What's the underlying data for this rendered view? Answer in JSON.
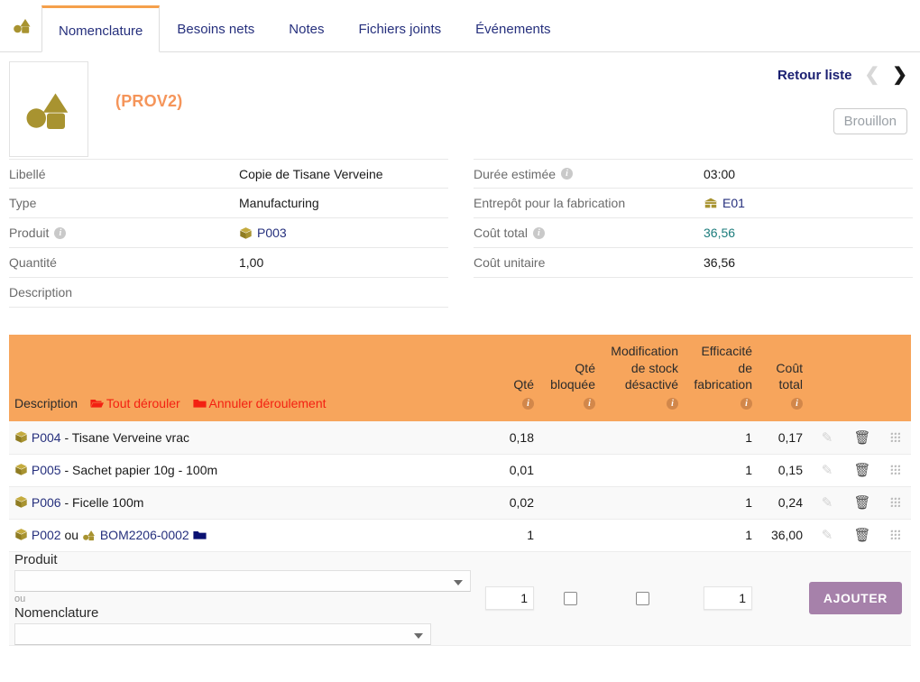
{
  "app": {
    "logo_icon": "bom-shapes-icon"
  },
  "tabs": [
    {
      "label": "Nomenclature",
      "active": true
    },
    {
      "label": "Besoins nets",
      "active": false
    },
    {
      "label": "Notes",
      "active": false
    },
    {
      "label": "Fichiers joints",
      "active": false
    },
    {
      "label": "Événements",
      "active": false
    }
  ],
  "header": {
    "thumbnail_icon": "bom-shapes-icon",
    "reference": "(PROV2)",
    "back_to_list": "Retour liste",
    "prev_icon": "chevron-left-icon",
    "next_icon": "chevron-right-icon",
    "status_badge": "Brouillon"
  },
  "info_left": [
    {
      "label": "Libellé",
      "info": false,
      "value": "Copie de Tisane Verveine",
      "style": "plain"
    },
    {
      "label": "Type",
      "info": false,
      "value": "Manufacturing",
      "style": "plain"
    },
    {
      "label": "Produit",
      "info": true,
      "value": "P003",
      "style": "link",
      "icon": "package-box-icon"
    },
    {
      "label": "Quantité",
      "info": false,
      "value": "1,00",
      "style": "plain"
    },
    {
      "label": "Description",
      "info": false,
      "value": "",
      "style": "plain"
    }
  ],
  "info_right": [
    {
      "label": "Durée estimée",
      "info": true,
      "value": "03:00",
      "style": "plain"
    },
    {
      "label": "Entrepôt pour la fabrication",
      "info": false,
      "value": "E01",
      "style": "link",
      "icon": "warehouse-icon"
    },
    {
      "label": "Coût total",
      "info": true,
      "value": "36,56",
      "style": "teal"
    },
    {
      "label": "Coût unitaire",
      "info": false,
      "value": "36,56",
      "style": "plain"
    }
  ],
  "bom_table": {
    "desc_header": "Description",
    "expand_all": "Tout dérouler",
    "expand_all_icon": "folder-open-icon",
    "collapse_all": "Annuler déroulement",
    "collapse_all_icon": "folder-closed-icon",
    "columns": [
      {
        "lines": [
          "Qté"
        ],
        "info": true
      },
      {
        "lines": [
          "Qté",
          "bloquée"
        ],
        "info": true
      },
      {
        "lines": [
          "Modification",
          "de stock",
          "désactivé"
        ],
        "info": true
      },
      {
        "lines": [
          "Efficacité",
          "de",
          "fabrication"
        ],
        "info": true
      },
      {
        "lines": [
          "Coût",
          "total"
        ],
        "info": true
      }
    ],
    "rows": [
      {
        "icon": "package-box-icon",
        "code": "P004",
        "text": " - Tisane Verveine vrac",
        "qte": "0,18",
        "qte_bloquee": "",
        "modif_stock": "",
        "efficacite": "1",
        "cout_total": "0,17",
        "edit_icon": "pencil-icon",
        "delete_icon": "trash-icon",
        "drag_icon": "drag-handle-icon"
      },
      {
        "icon": "package-box-icon",
        "code": "P005",
        "text": " - Sachet papier 10g - 100m",
        "qte": "0,01",
        "qte_bloquee": "",
        "modif_stock": "",
        "efficacite": "1",
        "cout_total": "0,15",
        "edit_icon": "pencil-icon",
        "delete_icon": "trash-icon",
        "drag_icon": "drag-handle-icon"
      },
      {
        "icon": "package-box-icon",
        "code": "P006",
        "text": " - Ficelle 100m",
        "qte": "0,02",
        "qte_bloquee": "",
        "modif_stock": "",
        "efficacite": "1",
        "cout_total": "0,24",
        "edit_icon": "pencil-icon",
        "delete_icon": "trash-icon",
        "drag_icon": "drag-handle-icon"
      },
      {
        "icon": "package-box-icon",
        "code": "P002",
        "text": " ou ",
        "bom_icon": "bom-shapes-icon",
        "bom_code": "BOM2206-0002",
        "folder_icon": "folder-navy-icon",
        "qte": "1",
        "qte_bloquee": "",
        "modif_stock": "",
        "efficacite": "1",
        "cout_total": "36,00",
        "edit_icon": "pencil-icon",
        "delete_icon": "trash-icon",
        "drag_icon": "drag-handle-icon"
      }
    ]
  },
  "add_form": {
    "produit_label": "Produit",
    "produit_value": "",
    "ou_label": "ou",
    "nomenclature_label": "Nomenclature",
    "nomenclature_value": "",
    "qte_value": "1",
    "qte_bloquee_checked": false,
    "modif_stock_checked": false,
    "efficacite_value": "1",
    "submit_label": "AJOUTER"
  },
  "colors": {
    "accent_orange": "#f7a55c",
    "title_orange": "#f5955a",
    "link_navy": "#26307d",
    "teal": "#1c7c7c",
    "olive": "#a89330",
    "red": "#f32112",
    "purple": "#a681aa"
  }
}
